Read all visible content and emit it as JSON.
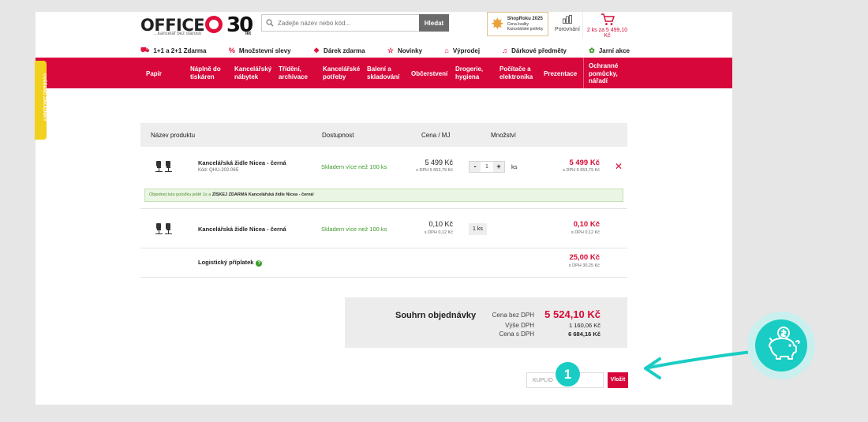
{
  "header": {
    "logo_text": "OFFICE",
    "tagline": "...kancelář bez starostí",
    "years": "30",
    "years_suffix": "let",
    "search_placeholder": "Zadejte název nebo kód...",
    "search_button": "Hledat",
    "badge_title": "ShopRoku 2025",
    "badge_line1": "Cena kvality",
    "badge_line2": "Kancelářské potřeby",
    "compare_label": "Porovnání",
    "cart_label": "2 ks za 5 499,10 Kč"
  },
  "promo": [
    {
      "icon": "gift-box-icon",
      "label": "1+1 a 2+1 Zdarma"
    },
    {
      "icon": "percent-icon",
      "label": "Množstevní slevy"
    },
    {
      "icon": "present-icon",
      "label": "Dárek zdarma"
    },
    {
      "icon": "star-icon",
      "label": "Novinky"
    },
    {
      "icon": "tag-icon",
      "label": "Výprodej"
    },
    {
      "icon": "bell-icon",
      "label": "Dárkové předměty"
    },
    {
      "icon": "flower-icon",
      "label": "Jarní akce"
    }
  ],
  "nav": [
    {
      "label": "Papír"
    },
    {
      "label": "Náplně do tiskáren"
    },
    {
      "label": "Kancelářský nábytek"
    },
    {
      "label": "Třídění, archivace"
    },
    {
      "label": "Kancelářské potřeby"
    },
    {
      "label": "Balení a skladování"
    },
    {
      "label": "Občerstvení"
    },
    {
      "label": "Drogerie, hygiena"
    },
    {
      "label": "Počítače a elektronika"
    },
    {
      "label": "Prezentace"
    },
    {
      "label": "Ochranné pomůcky, nářadí"
    }
  ],
  "side_tab": "OVĚŘENO ZÁKAZNÍKY",
  "table": {
    "headers": {
      "product": "Název produktu",
      "availability": "Dostupnost",
      "price": "Cena / MJ",
      "quantity": "Množství"
    },
    "rows": [
      {
        "name": "Kancelářská židle Nicea - černá",
        "code": "Kód: QHU-202.065",
        "availability": "Skladem více než 100 ks",
        "price": "5 499 Kč",
        "price_vat": "s DPH 6 653,79 Kč",
        "qty": "1",
        "unit": "ks",
        "total": "5 499 Kč",
        "total_vat": "s DPH 6 653,79 Kč"
      },
      {
        "name": "Kancelářská židle Nicea - černá",
        "availability": "Skladem více než 100 ks",
        "price": "0,10 Kč",
        "price_vat": "s DPH 0,12 Kč",
        "qty": "1 ks",
        "total": "0,10 Kč",
        "total_vat": "s DPH 0,12 Kč"
      },
      {
        "name": "Logistický příplatek",
        "total": "25,00 Kč",
        "total_vat": "s DPH 30,25 Kč"
      }
    ],
    "gift_note_prefix": "Objednej tuto položku ještě 1x a ",
    "gift_note_bold": "ZÍSKEJ ZDARMA Kancelářská židle Nicea - černá",
    "gift_note_suffix": "!",
    "info_icon": "?"
  },
  "summary": {
    "title": "Souhrn objednávky",
    "net_label": "Cena bez DPH",
    "net_value": "5 524,10 Kč",
    "vat_label": "Výše DPH",
    "vat_value": "1 160,06 Kč",
    "gross_label": "Cena s DPH",
    "gross_value": "6 684,16 Kč"
  },
  "coupon": {
    "value": "KUPLIO",
    "button": "Vložit"
  },
  "annotation": {
    "step": "1"
  },
  "colors": {
    "brand_red": "#d7063b",
    "teal": "#19cdc4",
    "stock_green": "#3c9b2a"
  }
}
